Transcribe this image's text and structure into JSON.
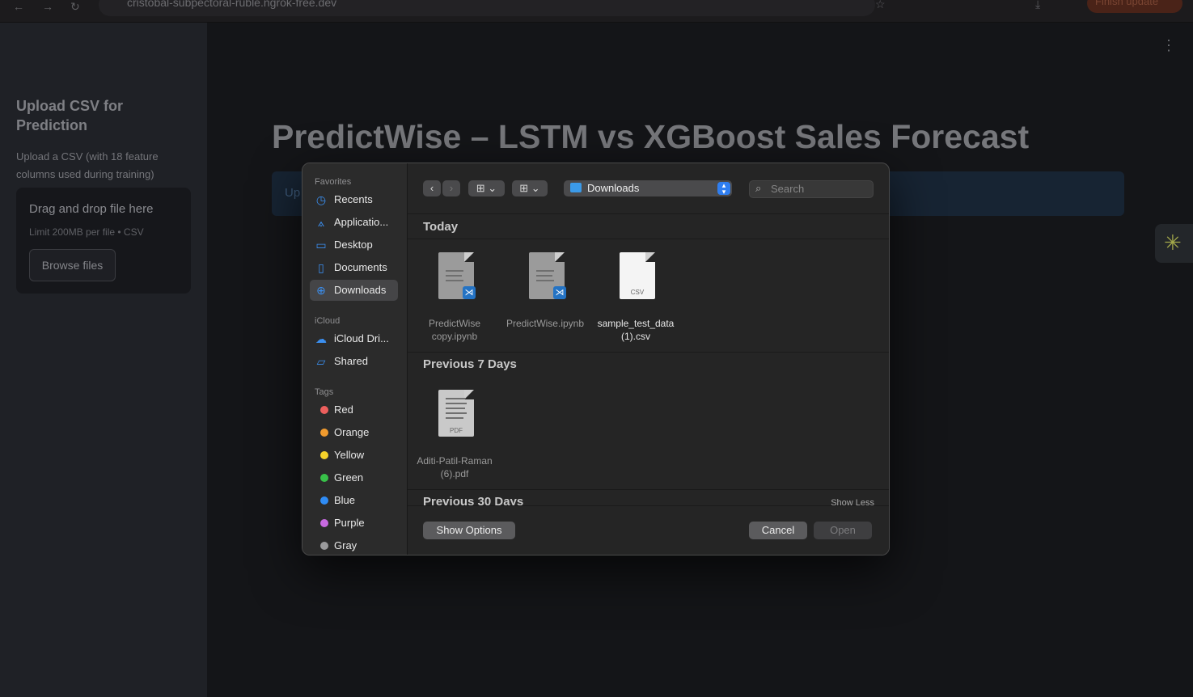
{
  "browser": {
    "url": "cristobal-subpectoral-ruble.ngrok-free.dev",
    "finish_update": "Finish update"
  },
  "sidebar": {
    "title": "Upload CSV for Prediction",
    "description": "Upload a CSV (with 18 feature columns used during training)",
    "dropzone": {
      "title": "Drag and drop file here",
      "subtitle": "Limit 200MB per file • CSV",
      "button": "Browse files"
    }
  },
  "main": {
    "title": "PredictWise – LSTM vs XGBoost Sales Forecast",
    "info_text": "Up"
  },
  "dialog": {
    "sidebar": {
      "favorites_label": "Favorites",
      "favorites": [
        {
          "label": "Recents",
          "icon": "clock-icon"
        },
        {
          "label": "Applicatio...",
          "icon": "applications-icon"
        },
        {
          "label": "Desktop",
          "icon": "desktop-icon"
        },
        {
          "label": "Documents",
          "icon": "document-icon"
        },
        {
          "label": "Downloads",
          "icon": "download-icon",
          "selected": true
        }
      ],
      "icloud_label": "iCloud",
      "icloud": [
        {
          "label": "iCloud Dri...",
          "icon": "cloud-icon"
        },
        {
          "label": "Shared",
          "icon": "shared-folder-icon"
        }
      ],
      "tags_label": "Tags",
      "tags": [
        {
          "label": "Red",
          "color": "#ec5f5d"
        },
        {
          "label": "Orange",
          "color": "#f19b2e"
        },
        {
          "label": "Yellow",
          "color": "#f5d22a"
        },
        {
          "label": "Green",
          "color": "#38c149"
        },
        {
          "label": "Blue",
          "color": "#2f8cf5"
        },
        {
          "label": "Purple",
          "color": "#c86ae0"
        },
        {
          "label": "Gray",
          "color": "#9a9a9c"
        }
      ]
    },
    "toolbar": {
      "location": "Downloads",
      "search_placeholder": "Search"
    },
    "sections": [
      {
        "title": "Today",
        "files": [
          {
            "name_line1": "PredictWise",
            "name_line2": "copy.ipynb",
            "kind": "ipynb"
          },
          {
            "name_line1": "PredictWise.ipynb",
            "name_line2": "",
            "kind": "ipynb"
          },
          {
            "name_line1": "sample_test_data",
            "name_line2": "(1).csv",
            "kind": "csv",
            "ext": "CSV"
          }
        ]
      },
      {
        "title": "Previous 7 Days",
        "files": [
          {
            "name_line1": "Aditi-Patil-Raman",
            "name_line2": "(6).pdf",
            "kind": "pdf",
            "ext": "PDF"
          }
        ]
      },
      {
        "title": "Previous 30 Days",
        "action": "Show Less"
      }
    ],
    "footer": {
      "show_options": "Show Options",
      "cancel": "Cancel",
      "open": "Open"
    }
  }
}
